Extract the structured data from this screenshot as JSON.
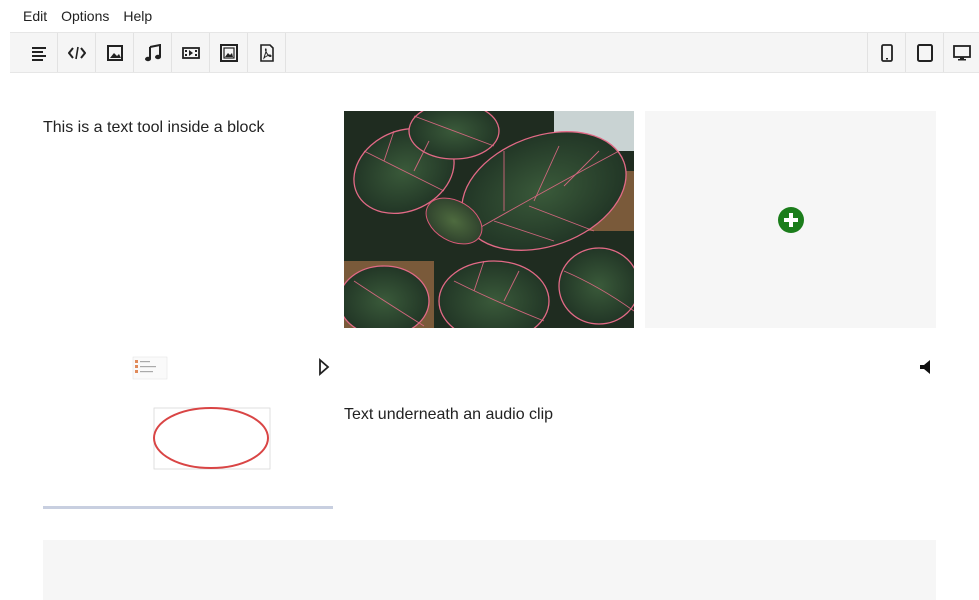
{
  "menu": [
    "Edit",
    "Options",
    "Help"
  ],
  "toolbar": {
    "left_tools": [
      "text-tool-icon",
      "code-tool-icon",
      "image-tool-icon",
      "audio-tool-icon",
      "video-tool-icon",
      "image-gallery-tool-icon",
      "pdf-tool-icon"
    ],
    "right_tools": [
      "phone-preview-icon",
      "tablet-preview-icon",
      "desktop-preview-icon"
    ]
  },
  "blocks": {
    "text1": "This is a text tool inside a block",
    "text2": "Text underneath an audio clip"
  },
  "colors": {
    "add_button": "#1b7d1b",
    "toolbar_bg": "#f5f5f5",
    "placeholder_bg": "#f6f6f6",
    "ellipse": "#d94545"
  }
}
